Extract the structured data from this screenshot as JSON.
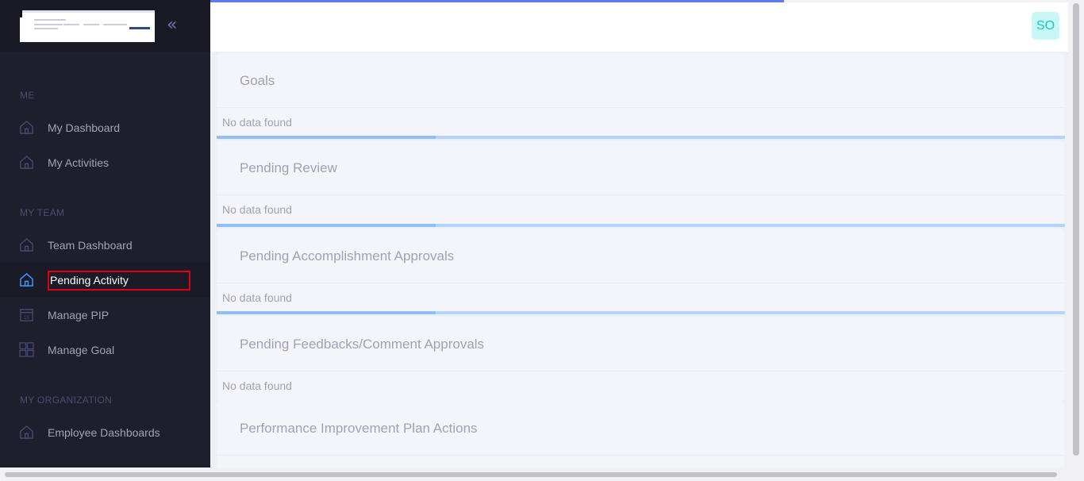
{
  "sidebar": {
    "logo_name": "company-logo",
    "collapse_icon": "double-chevron-left-icon",
    "sections": [
      {
        "title": "ME"
      },
      {
        "title": "MY TEAM"
      },
      {
        "title": "MY ORGANIZATION"
      }
    ],
    "items": [
      {
        "label": "My Dashboard",
        "icon": "home-icon"
      },
      {
        "label": "My Activities",
        "icon": "home-icon"
      },
      {
        "label": "Team Dashboard",
        "icon": "home-icon"
      },
      {
        "label": "Pending Activity",
        "icon": "home-icon",
        "active": true
      },
      {
        "label": "Manage PIP",
        "icon": "calendar-icon"
      },
      {
        "label": "Manage Goal",
        "icon": "grid-icon"
      },
      {
        "label": "Employee Dashboards",
        "icon": "home-icon"
      }
    ]
  },
  "header": {
    "avatar_initials": "SO"
  },
  "cards": [
    {
      "title": "Goals",
      "empty_text": "No data found"
    },
    {
      "title": "Pending Review",
      "empty_text": "No data found"
    },
    {
      "title": "Pending Accomplishment Approvals",
      "empty_text": "No data found"
    },
    {
      "title": "Pending Feedbacks/Comment Approvals",
      "empty_text": "No data found"
    },
    {
      "title": "Performance Improvement Plan Actions"
    }
  ],
  "colors": {
    "sidebar_bg": "#1e1e2d",
    "accent": "#5d78ff",
    "active_icon": "#3699ff",
    "avatar_bg": "#c9f7f5",
    "avatar_text": "#1bc5bd",
    "highlight": "#e00012"
  }
}
